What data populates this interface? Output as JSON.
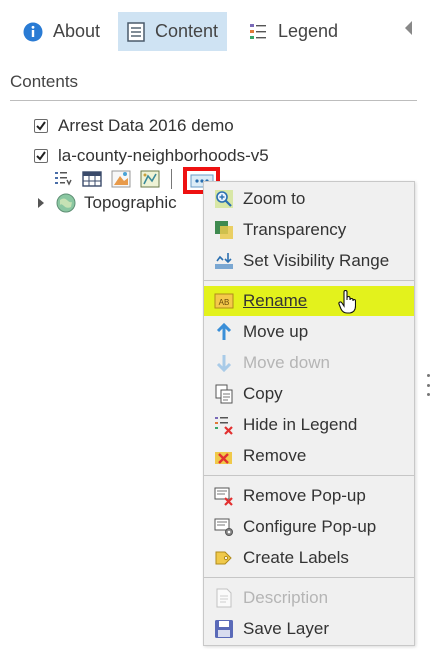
{
  "tabs": [
    {
      "label": "About",
      "icon": "info-icon"
    },
    {
      "label": "Content",
      "icon": "content-icon",
      "active": true
    },
    {
      "label": "Legend",
      "icon": "legend-icon"
    }
  ],
  "section_title": "Contents",
  "layers": [
    {
      "name": "Arrest Data 2016 demo",
      "checked": true
    },
    {
      "name": "la-county-neighborhoods-v5",
      "checked": true
    },
    {
      "name": "Topographic",
      "checked": false
    }
  ],
  "menu": {
    "groups": [
      [
        {
          "label": "Zoom to",
          "icon": "zoom-to-icon"
        },
        {
          "label": "Transparency",
          "icon": "transparency-icon"
        },
        {
          "label": "Set Visibility Range",
          "icon": "visibility-range-icon"
        }
      ],
      [
        {
          "label": "Rename",
          "icon": "rename-icon",
          "highlighted": true
        },
        {
          "label": "Move up",
          "icon": "arrow-up-icon"
        },
        {
          "label": "Move down",
          "icon": "arrow-down-icon",
          "disabled": true
        },
        {
          "label": "Copy",
          "icon": "copy-icon"
        },
        {
          "label": "Hide in Legend",
          "icon": "hide-legend-icon"
        },
        {
          "label": "Remove",
          "icon": "remove-icon"
        }
      ],
      [
        {
          "label": "Remove Pop-up",
          "icon": "remove-popup-icon"
        },
        {
          "label": "Configure Pop-up",
          "icon": "configure-popup-icon"
        },
        {
          "label": "Create Labels",
          "icon": "labels-icon"
        }
      ],
      [
        {
          "label": "Description",
          "icon": "description-icon",
          "disabled": true
        },
        {
          "label": "Save Layer",
          "icon": "save-icon"
        }
      ]
    ]
  },
  "colors": {
    "active_tab": "#cfe3f3",
    "highlight": "#e3f21c",
    "focus_border": "#ee1111",
    "info_blue": "#2a7bd4"
  }
}
